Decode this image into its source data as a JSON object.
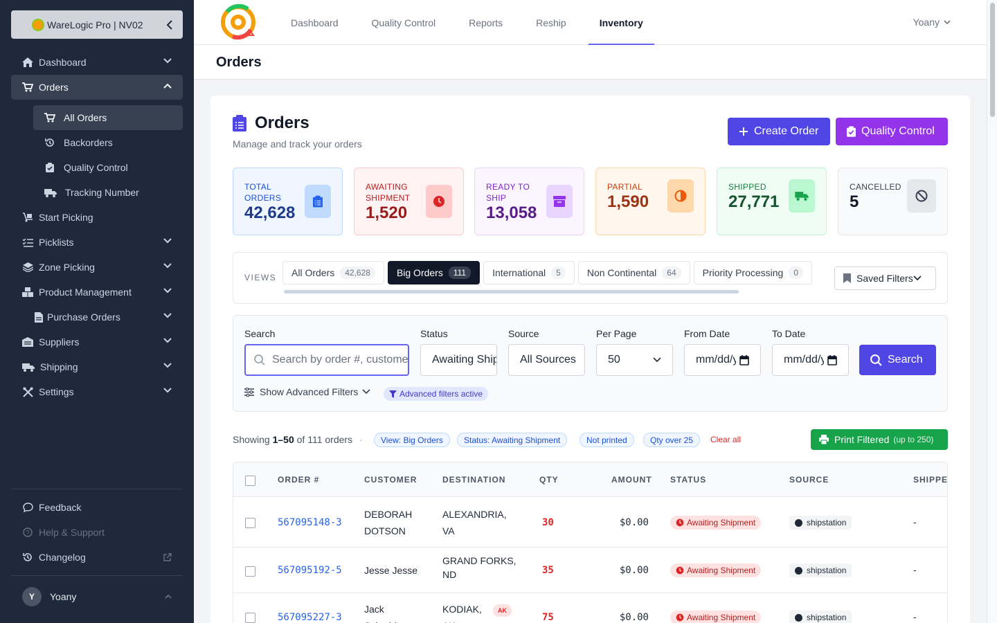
{
  "sidebar": {
    "brand": "WareLogic Pro | NV02",
    "items": [
      {
        "label": "Dashboard"
      },
      {
        "label": "Orders"
      },
      {
        "label": "Start Picking"
      },
      {
        "label": "Picklists"
      },
      {
        "label": "Zone Picking"
      },
      {
        "label": "Product Management"
      },
      {
        "label": "Purchase Orders"
      },
      {
        "label": "Suppliers"
      },
      {
        "label": "Shipping"
      },
      {
        "label": "Settings"
      }
    ],
    "orders_sub": [
      {
        "label": "All Orders"
      },
      {
        "label": "Backorders"
      },
      {
        "label": "Quality Control"
      },
      {
        "label": "Tracking Number"
      }
    ],
    "bottom": [
      {
        "label": "Feedback"
      },
      {
        "label": "Help & Support"
      },
      {
        "label": "Changelog"
      }
    ],
    "user": {
      "initial": "Y",
      "name": "Yoany"
    }
  },
  "topnav": {
    "tabs": [
      {
        "label": "Dashboard"
      },
      {
        "label": "Quality Control"
      },
      {
        "label": "Reports"
      },
      {
        "label": "Reship"
      },
      {
        "label": "Inventory"
      }
    ],
    "user": "Yoany"
  },
  "page": {
    "header_title": "Orders",
    "title": "Orders",
    "subtitle": "Manage and track your orders"
  },
  "actions": {
    "create": "Create Order",
    "qc": "Quality Control"
  },
  "stats": [
    {
      "label": "TOTAL ORDERS",
      "value": "42,628",
      "color": "#1e3a8a"
    },
    {
      "label": "AWAITING SHIPMENT",
      "value": "1,520",
      "color": "#991b1b"
    },
    {
      "label": "READY TO SHIP",
      "value": "13,058",
      "color": "#581c87"
    },
    {
      "label": "PARTIAL",
      "value": "1,590",
      "color": "#9a3412"
    },
    {
      "label": "SHIPPED",
      "value": "27,771",
      "color": "#14532d"
    },
    {
      "label": "CANCELLED",
      "value": "5",
      "color": "#111827"
    }
  ],
  "views": {
    "label": "VIEWS",
    "tabs": [
      {
        "label": "All Orders",
        "count": "42,628"
      },
      {
        "label": "Big Orders",
        "count": "111"
      },
      {
        "label": "International",
        "count": "5"
      },
      {
        "label": "Non Continental",
        "count": "64"
      },
      {
        "label": "Priority Processing",
        "count": "0"
      }
    ],
    "saved": "Saved Filters"
  },
  "filters": {
    "search": {
      "label": "Search",
      "placeholder": "Search by order #, customer"
    },
    "status": {
      "label": "Status",
      "value": "Awaiting Shipment"
    },
    "source": {
      "label": "Source",
      "value": "All Sources"
    },
    "per_page": {
      "label": "Per Page",
      "value": "50"
    },
    "from_date": {
      "label": "From Date",
      "value": "mm/dd/yyyy"
    },
    "to_date": {
      "label": "To Date",
      "value": "mm/dd/yyyy"
    },
    "search_button": "Search",
    "advanced": "Show Advanced Filters",
    "advanced_active": "Advanced filters active"
  },
  "results": {
    "showing_prefix": "Showing",
    "range": "1–50",
    "of_text": "of 111 orders",
    "chips": [
      "View: Big Orders",
      "Status: Awaiting Shipment",
      "Not printed",
      "Qty over 25"
    ],
    "clear": "Clear all",
    "print": "Print Filtered",
    "print_note": "(up to 250)"
  },
  "table": {
    "headers": [
      "ORDER #",
      "CUSTOMER",
      "DESTINATION",
      "QTY",
      "AMOUNT",
      "STATUS",
      "SOURCE",
      "SHIPPED"
    ],
    "rows": [
      {
        "order": "567095148-3",
        "customer_1": "DEBORAH",
        "customer_2": "DOTSON",
        "dest_1": "ALEXANDRIA,",
        "dest_2": "VA",
        "qty": "30",
        "amount": "$0.00",
        "status": "Awaiting Shipment",
        "source": "shipstation",
        "shipped": "-"
      },
      {
        "order": "567095192-5",
        "customer_1": "Jesse Jesse",
        "customer_2": "",
        "dest_1": "GRAND FORKS,",
        "dest_2": "ND",
        "qty": "35",
        "amount": "$0.00",
        "status": "Awaiting Shipment",
        "source": "shipstation",
        "shipped": "-"
      },
      {
        "order": "567095227-3",
        "customer_1": "Jack",
        "customer_2": "Schmidt",
        "dest_1": "KODIAK,",
        "dest_2": "AK",
        "tag": "AK",
        "qty": "75",
        "amount": "$0.00",
        "status": "Awaiting Shipment",
        "source": "shipstation",
        "shipped": "-"
      }
    ]
  }
}
